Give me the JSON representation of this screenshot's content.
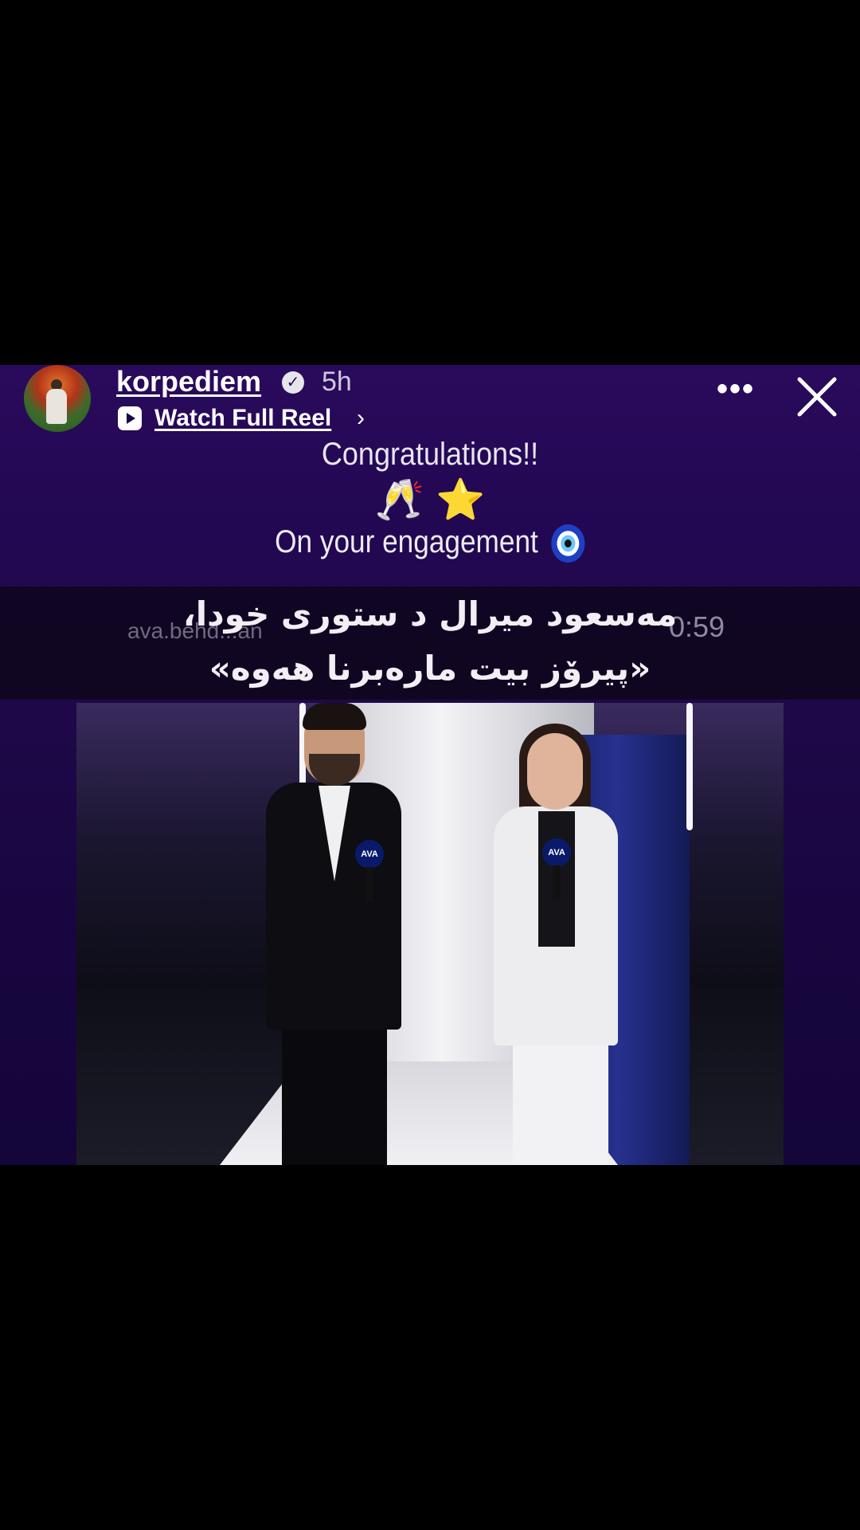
{
  "story": {
    "username": "korpediem",
    "verified_icon": "verified-badge-icon",
    "time_ago": "5h",
    "watch_label": "Watch Full Reel",
    "chevron": "›",
    "more_icon": "more-icon",
    "close_icon": "close-icon"
  },
  "greeting": {
    "title": "Congratulations!!",
    "emojis": "🥂 ⭐",
    "subtitle": "On your engagement"
  },
  "caption": {
    "line1": "مەسعود میرال د ستوری خودا،",
    "line2": "«پیرۆز بیت مارەبرنا هەوە»",
    "watermark": "ava.behd...an",
    "timecode": "0:59"
  },
  "video": {
    "mic_logo": "AVA"
  }
}
